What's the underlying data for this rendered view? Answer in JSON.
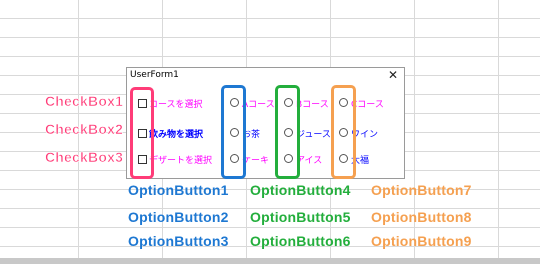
{
  "form": {
    "title": "UserForm1",
    "close": "✕"
  },
  "checkboxes": [
    {
      "label": "コースを選択",
      "color": "#ff00ff"
    },
    {
      "label": "飲み物を選択",
      "color": "#0000ff"
    },
    {
      "label": "デザートを選択",
      "color": "#ff00ff"
    }
  ],
  "options": {
    "col1": [
      "Aコース",
      "お茶",
      "ケーキ"
    ],
    "col2": [
      "Bコース",
      "ジュース",
      "アイス"
    ],
    "col3": [
      "Cコース",
      "ワイン",
      "大福"
    ]
  },
  "annotations": {
    "checkbox": [
      "CheckBox1",
      "CheckBox2",
      "CheckBox3"
    ],
    "col1": [
      "OptionButton1",
      "OptionButton2",
      "OptionButton3"
    ],
    "col2": [
      "OptionButton4",
      "OptionButton5",
      "OptionButton6"
    ],
    "col3": [
      "OptionButton7",
      "OptionButton8",
      "OptionButton9"
    ]
  },
  "colors": {
    "pink": "#ff3c78",
    "blue": "#1e78d2",
    "green": "#23ae3c",
    "orange": "#f5a050"
  }
}
